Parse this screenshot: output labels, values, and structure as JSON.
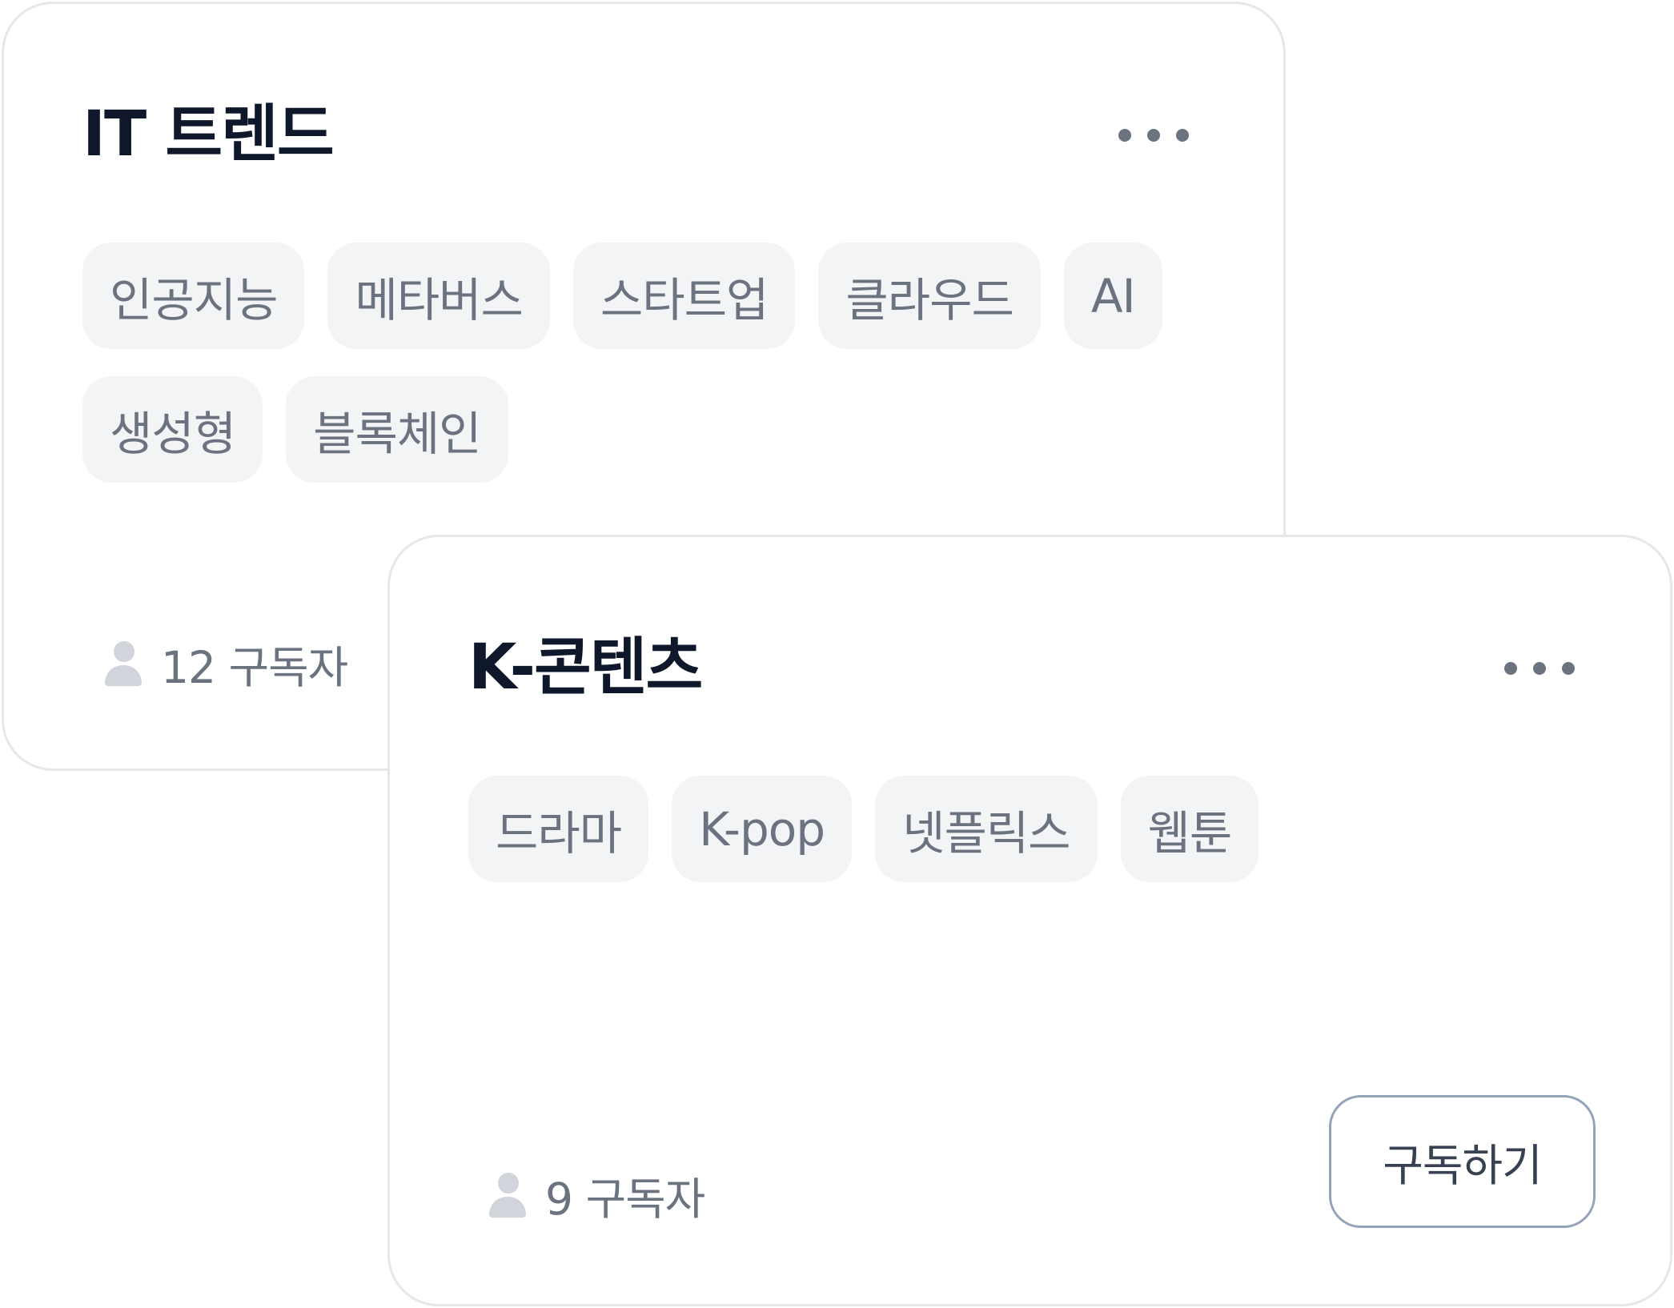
{
  "cards": [
    {
      "title": "IT 트렌드",
      "tags": [
        "인공지능",
        "메타버스",
        "스타트업",
        "클라우드",
        "AI",
        "생성형",
        "블록체인"
      ],
      "subscriber_text": "12 구독자",
      "icons": {
        "more": "more-horizontal-icon",
        "subscriber": "user-icon"
      }
    },
    {
      "title": "K-콘텐츠",
      "tags": [
        "드라마",
        "K-pop",
        "넷플릭스",
        "웹툰"
      ],
      "subscriber_text": "9 구독자",
      "subscribe_label": "구독하기",
      "icons": {
        "more": "more-horizontal-icon",
        "subscriber": "user-icon"
      }
    }
  ],
  "colors": {
    "title": "#0f172a",
    "tag_background": "#f3f4f6",
    "tag_text": "#6b7280",
    "card_border": "#e5e7eb",
    "icon_gray": "#d1d5db",
    "button_border": "#94a3b8"
  }
}
